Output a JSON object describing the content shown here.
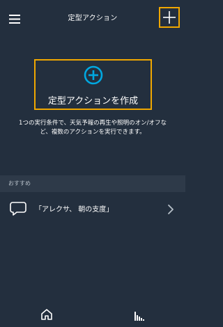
{
  "header": {
    "title": "定型アクション",
    "menu_icon": "hamburger-menu-icon",
    "add_icon": "plus-icon"
  },
  "create": {
    "icon": "plus-circle-icon",
    "label": "定型アクションを作成"
  },
  "description": "1つの実行条件で、天気予報の再生や照明のオン/オフなど、複数のアクションを実行できます。",
  "recommended": {
    "section_label": "おすすめ",
    "items": [
      {
        "icon": "speech-bubble-icon",
        "label": "「アレクサ、 朝の支度」",
        "chevron": "chevron-right-icon"
      }
    ]
  },
  "bottom_nav": {
    "items": [
      {
        "icon": "home-icon"
      },
      {
        "icon": "activity-bars-icon"
      }
    ]
  },
  "colors": {
    "background": "#232f3e",
    "accent": "#f0a700",
    "icon_blue": "#00a8e1",
    "section_bg": "#2e3a49"
  }
}
